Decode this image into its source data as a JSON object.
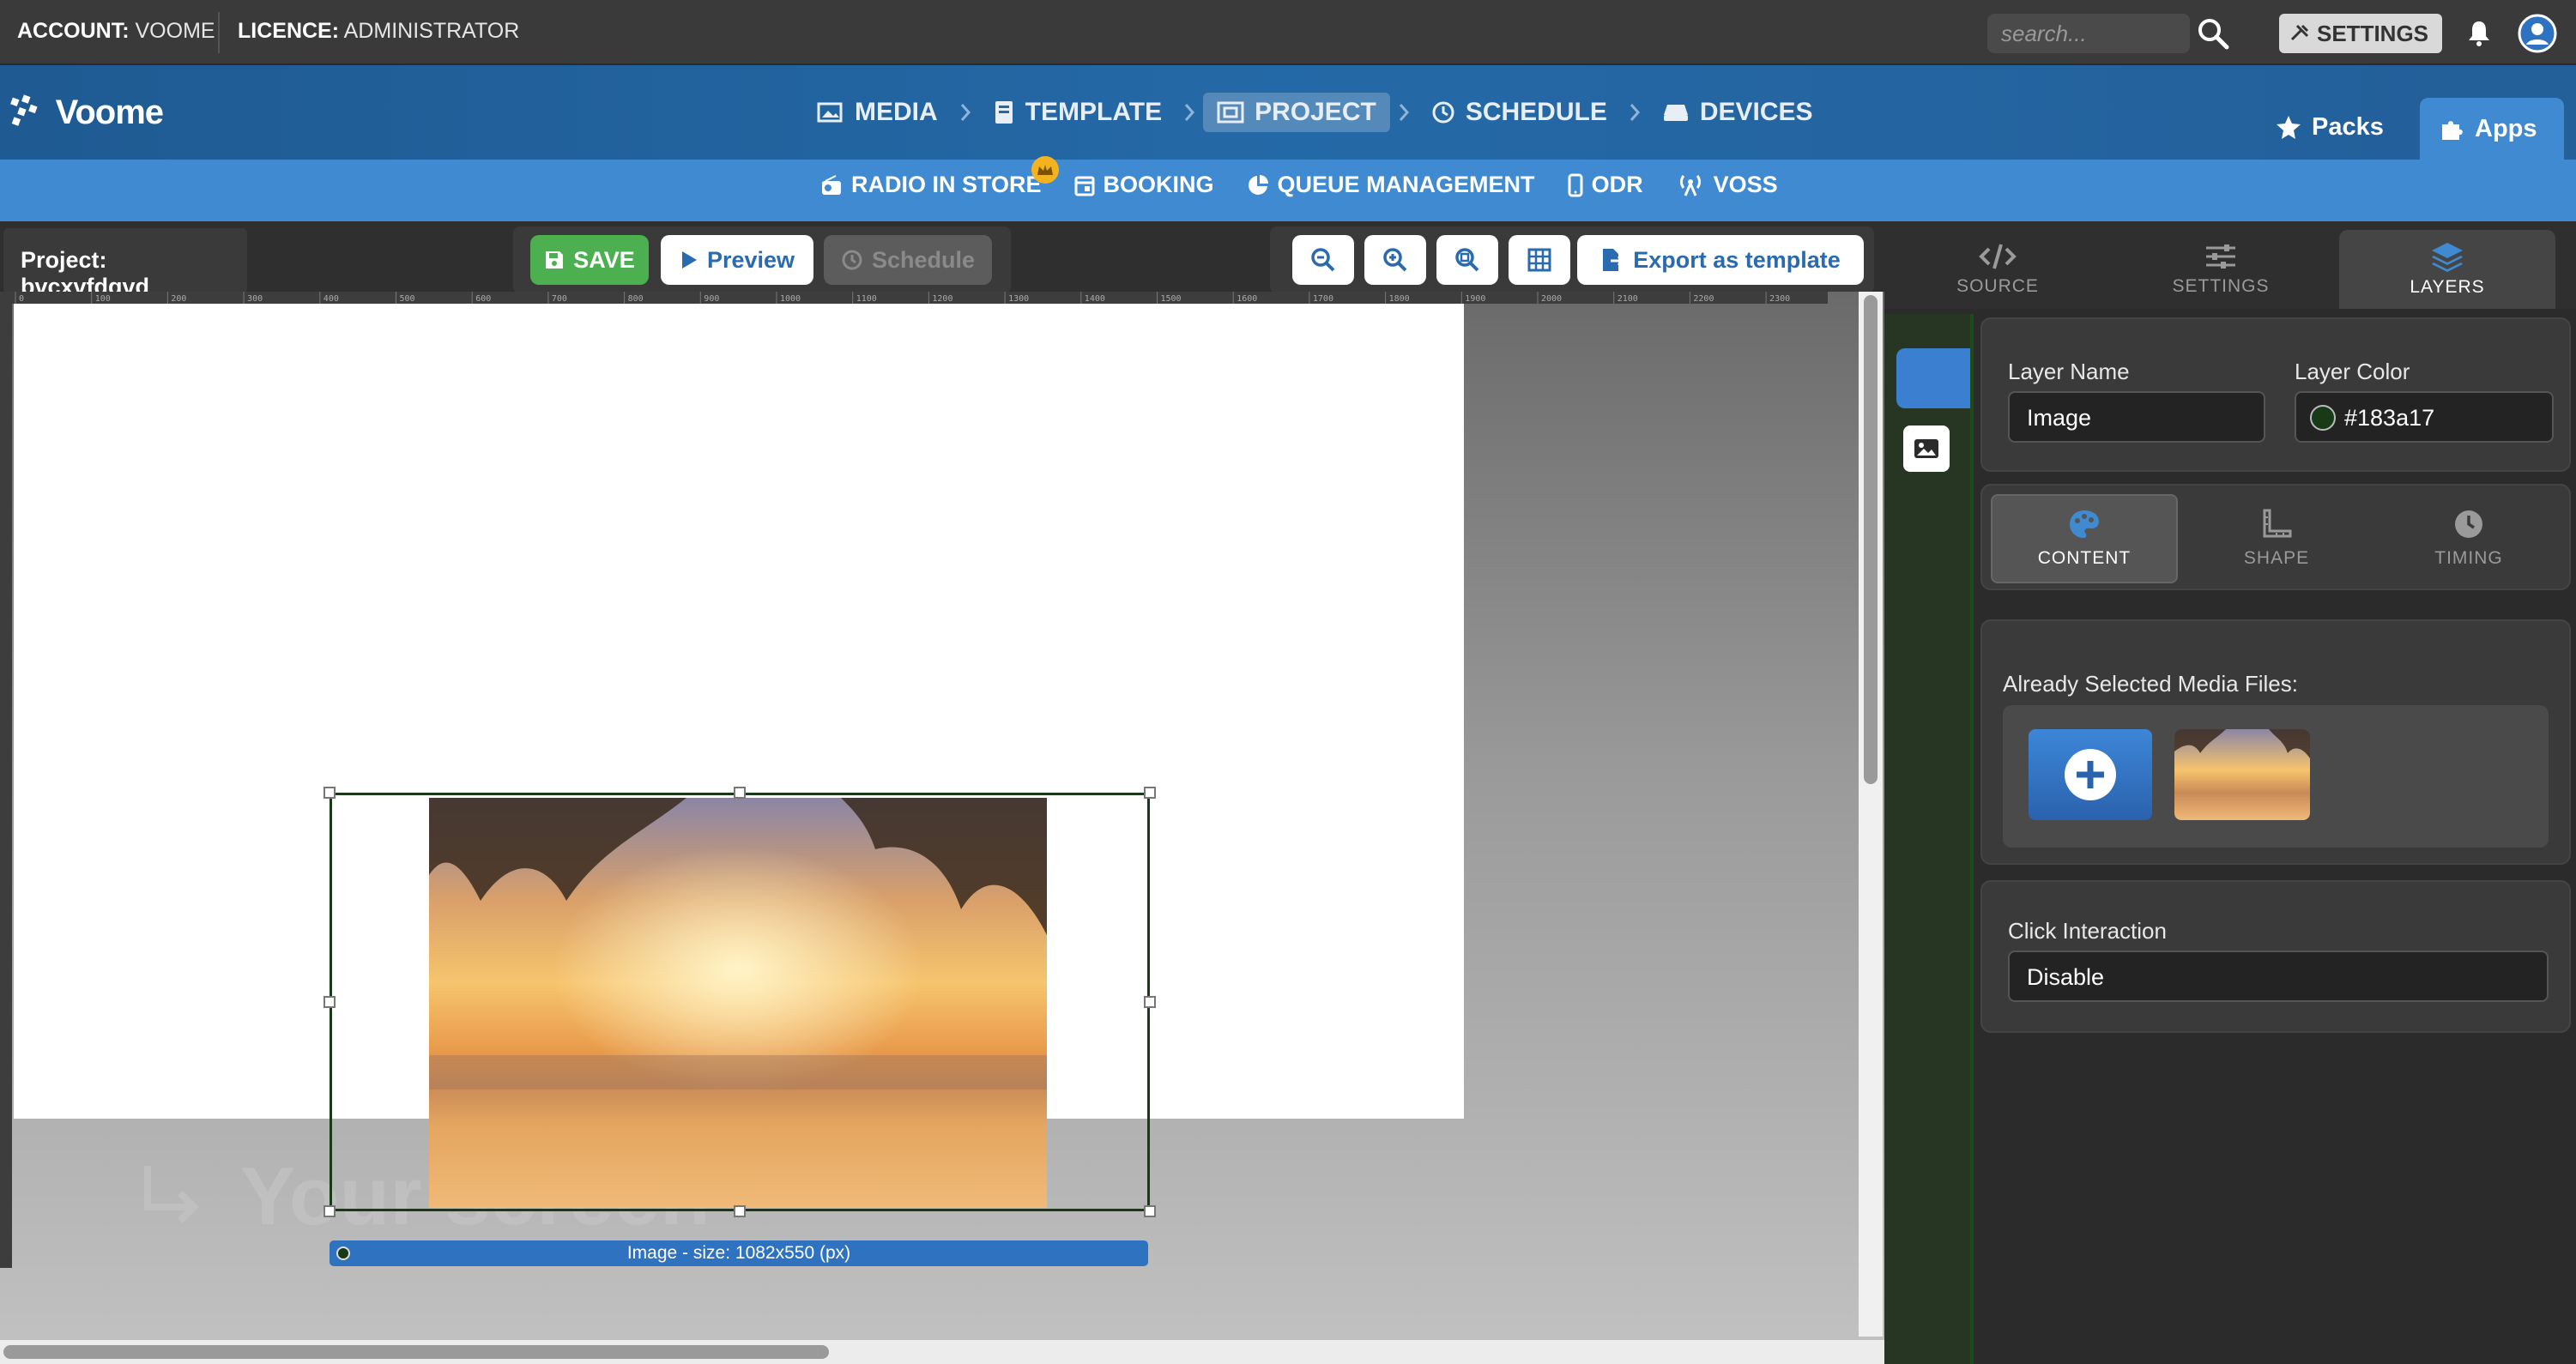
{
  "account": {
    "label": "ACCOUNT:",
    "value": "VOOME"
  },
  "licence": {
    "label": "LICENCE:",
    "value": "ADMINISTRATOR"
  },
  "search": {
    "placeholder": "search..."
  },
  "settings_label": "SETTINGS",
  "brand": {
    "name": "Voome"
  },
  "nav": [
    {
      "label": "MEDIA",
      "icon": "image-icon"
    },
    {
      "label": "TEMPLATE",
      "icon": "book-icon"
    },
    {
      "label": "PROJECT",
      "icon": "project-icon",
      "active": true
    },
    {
      "label": "SCHEDULE",
      "icon": "clock-icon"
    },
    {
      "label": "DEVICES",
      "icon": "device-icon"
    }
  ],
  "tabs": {
    "packs": "Packs",
    "apps": "Apps"
  },
  "apps": [
    {
      "label": "RADIO IN STORE",
      "icon": "radio-icon",
      "crown": true
    },
    {
      "label": "BOOKING",
      "icon": "calendar-icon"
    },
    {
      "label": "QUEUE MANAGEMENT",
      "icon": "pie-icon"
    },
    {
      "label": "ODR",
      "icon": "mobile-icon"
    },
    {
      "label": "VOSS",
      "icon": "broadcast-icon"
    }
  ],
  "project": {
    "label": "Project:",
    "name": "bvcxvfdgvd"
  },
  "toolbar": {
    "save": "SAVE",
    "preview": "Preview",
    "schedule": "Schedule",
    "export": "Export as template"
  },
  "ruler_ticks": [
    "0",
    "100",
    "200",
    "300",
    "400",
    "500",
    "600",
    "700",
    "800",
    "900",
    "1000",
    "1100",
    "1200",
    "1300",
    "1400",
    "1500",
    "1600",
    "1700",
    "1800",
    "1900",
    "2000",
    "2100",
    "2200",
    "2300"
  ],
  "canvas": {
    "watermark": "Your screen",
    "size_label": "Image - size: 1082x550 (px)"
  },
  "right_tabs": [
    {
      "label": "SOURCE",
      "icon": "code-icon"
    },
    {
      "label": "SETTINGS",
      "icon": "sliders-icon"
    },
    {
      "label": "LAYERS",
      "icon": "layers-icon",
      "active": true
    }
  ],
  "layer": {
    "name_label": "Layer Name",
    "name_value": "Image",
    "color_label": "Layer Color",
    "color_value": "#183a17"
  },
  "content_tabs": [
    {
      "label": "CONTENT",
      "icon": "palette-icon",
      "active": true
    },
    {
      "label": "SHAPE",
      "icon": "ruler-icon"
    },
    {
      "label": "TIMING",
      "icon": "clock-icon"
    }
  ],
  "media": {
    "label": "Already Selected Media Files:"
  },
  "click": {
    "label": "Click Interaction",
    "value": "Disable"
  },
  "colors": {
    "header_blue": "#2469a7",
    "apps_blue": "#3f8ad0",
    "save_green": "#4caf50",
    "layer_color": "#183a17"
  }
}
